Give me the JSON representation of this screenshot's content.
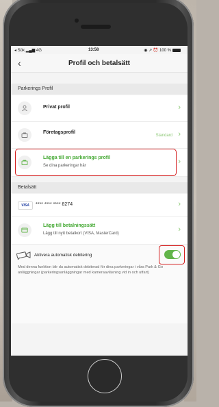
{
  "statusbar": {
    "carrier": "◂ Sök",
    "network": "4G",
    "time": "13:58",
    "battery": "◉ ↗ ⏰ 100 %"
  },
  "nav": {
    "back_glyph": "‹",
    "title": "Profil och betalsätt"
  },
  "parking_section": {
    "header": "Parkerings Profil",
    "private_profile": "Privat profil",
    "company_profile": "Företagsprofil",
    "company_badge": "Standard",
    "add_profile_title": "Lägga till en parkerings profil",
    "add_profile_sub": "Se dina parkeringar här"
  },
  "payment_section": {
    "header": "Betalsätt",
    "card_brand": "VISA",
    "card_number": "**** **** **** 8274",
    "add_method_title": "Lägg till betalningssätt",
    "add_method_sub": "Lägg till nytt betalkort (VISA, MasterCard)"
  },
  "auto_debit": {
    "label": "Aktivera automatisk debitering",
    "enabled": true,
    "note": "Med denna funktion blir du automatisk debiterad för dina parkeringar i våra Park & Go anläggningar (parkeringsanläggningar med kameraavläsning vid in och utfart)"
  },
  "chevron": "›",
  "colors": {
    "accent": "#62b54a",
    "highlight": "#d42020"
  }
}
